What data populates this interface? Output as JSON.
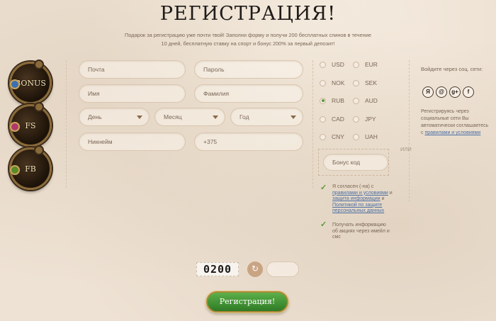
{
  "page": {
    "title": "РЕГИСТРАЦИЯ!",
    "subtitle": "Подарок за регистрацию уже почти твой! Заполни форму и получи 200 бесплатных спинов в течение 10 дней, бесплатную ставку на спорт и бонус 200% за первый депозит!"
  },
  "badges": [
    "BONUS",
    "FS",
    "FB"
  ],
  "form": {
    "email_placeholder": "Почта",
    "password_placeholder": "Пароль",
    "firstname_placeholder": "Имя",
    "lastname_placeholder": "Фамилия",
    "day_label": "День",
    "month_label": "Месяц",
    "year_label": "Год",
    "nickname_placeholder": "Никнейм",
    "phone_value": "+375"
  },
  "currencies": [
    {
      "code": "USD",
      "selected": false
    },
    {
      "code": "EUR",
      "selected": false
    },
    {
      "code": "NOK",
      "selected": false
    },
    {
      "code": "SEK",
      "selected": false
    },
    {
      "code": "RUB",
      "selected": true
    },
    {
      "code": "AUD",
      "selected": false
    },
    {
      "code": "CAD",
      "selected": false
    },
    {
      "code": "JPY",
      "selected": false
    },
    {
      "code": "CNY",
      "selected": false
    },
    {
      "code": "UAH",
      "selected": false
    }
  ],
  "bonus": {
    "code_placeholder": "Бонус код",
    "or_label": "ИЛИ"
  },
  "agreements": {
    "terms_prefix": "Я согласен (-на) с",
    "terms_link": "правилами и условиями",
    "terms_middle": "и",
    "privacy_link": "защита информации",
    "privacy_middle": "и",
    "policy_link": "Политикой по защите персональных данных",
    "newsletter": "Получать информацию об акциях через имейл и смс"
  },
  "social": {
    "title": "Войдите через соц. сети:",
    "icons": [
      "Я",
      "@",
      "g+",
      "f"
    ],
    "note_prefix": "Регистрируясь через социальные сети Вы автоматически соглашаетесь с",
    "note_link": "правилами и условиями"
  },
  "captcha": {
    "code": "0200",
    "refresh_icon": "refresh-icon"
  },
  "actions": {
    "register_label": "Регистрация!"
  },
  "colors": {
    "background": "#eee2d4",
    "accent_green": "#3f8f32",
    "link_blue": "#4a6fa5"
  }
}
